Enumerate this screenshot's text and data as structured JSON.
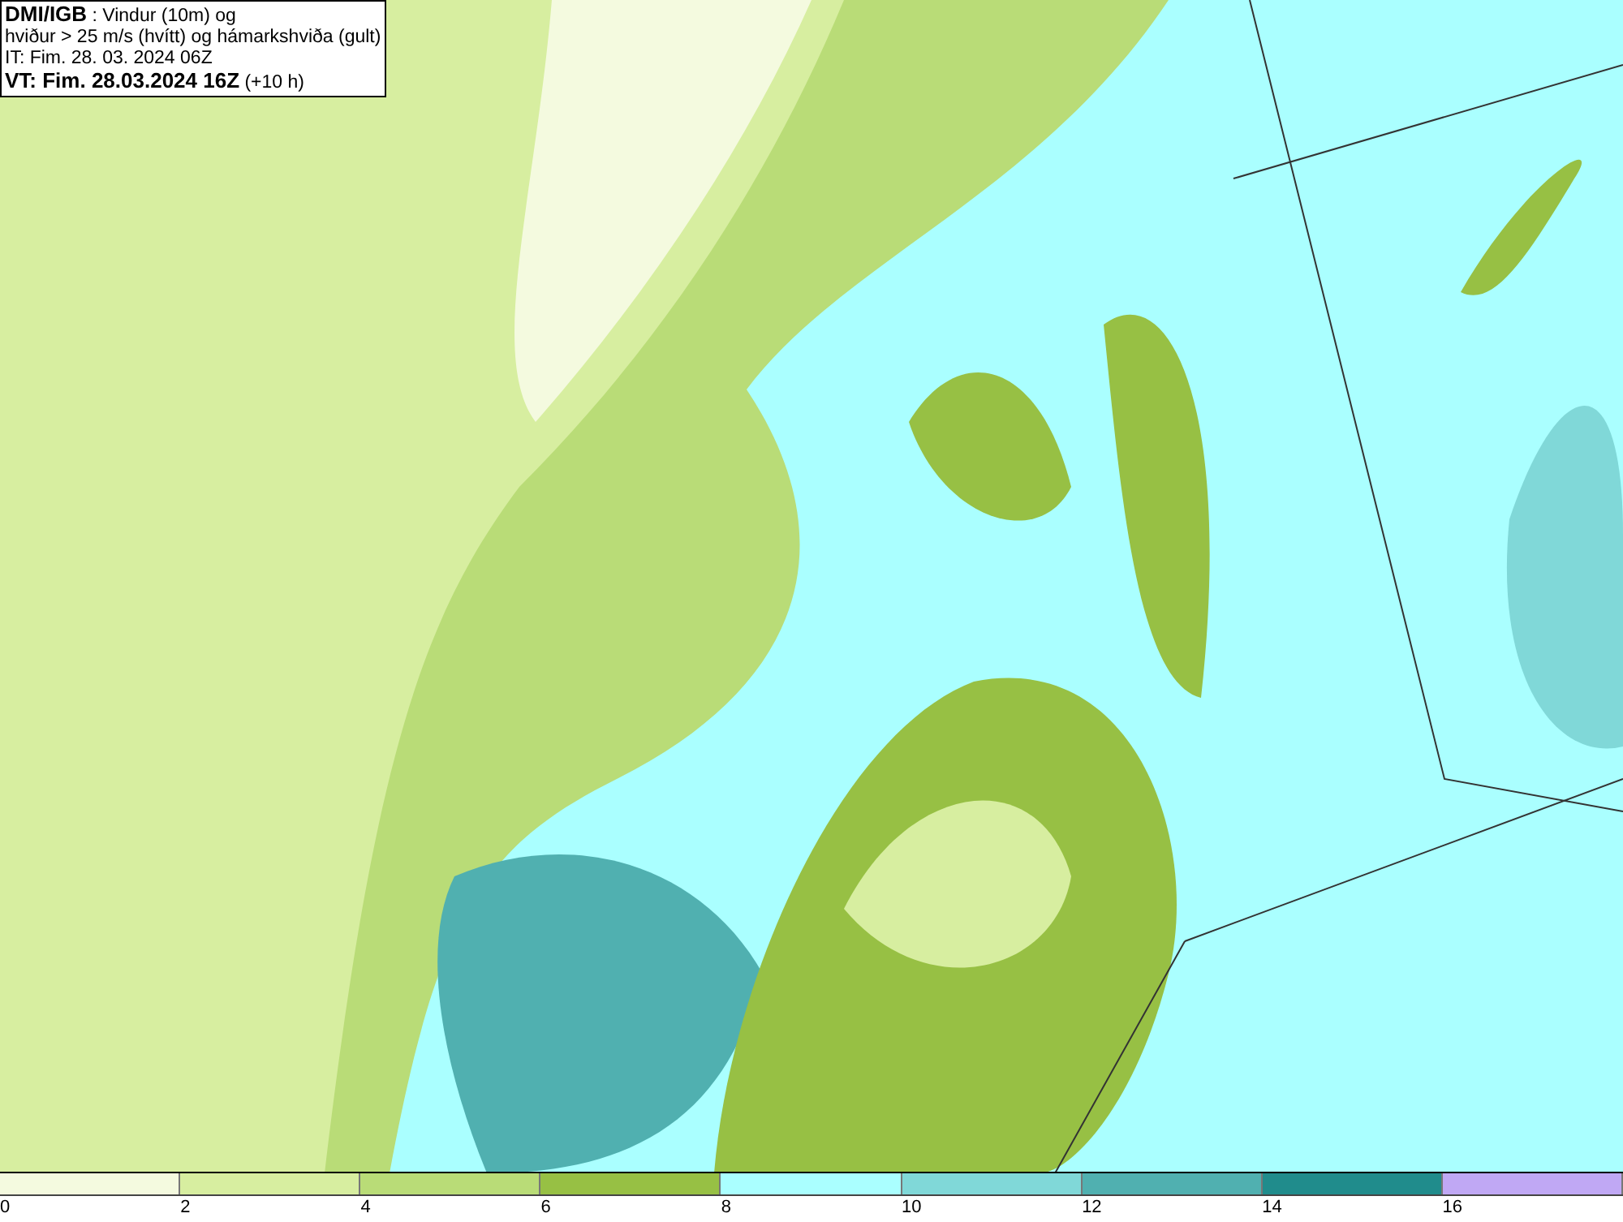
{
  "title_box": {
    "lines": [
      "**DMI/IGB** : Vindur (10m) og",
      "hviður > 25 m/s (hvítt) og hámarkshviða (gult)",
      "IT: Fim. 28. 03. 2024 06Z",
      "**VT: Fim. 28.03.2024 16Z** (+10 h)"
    ]
  },
  "legend": {
    "segments": [
      {
        "color": "#f4fadf"
      },
      {
        "color": "#d7eea0"
      },
      {
        "color": "#b9dc77"
      },
      {
        "color": "#97c044"
      },
      {
        "color": "#aaffff"
      },
      {
        "color": "#80d8d8"
      },
      {
        "color": "#50b0b0"
      },
      {
        "color": "#208c8c"
      },
      {
        "color": "#c0a8f4"
      }
    ],
    "ticks": [
      "0",
      "2",
      "4",
      "6",
      "8",
      "10",
      "12",
      "14",
      "16"
    ]
  }
}
